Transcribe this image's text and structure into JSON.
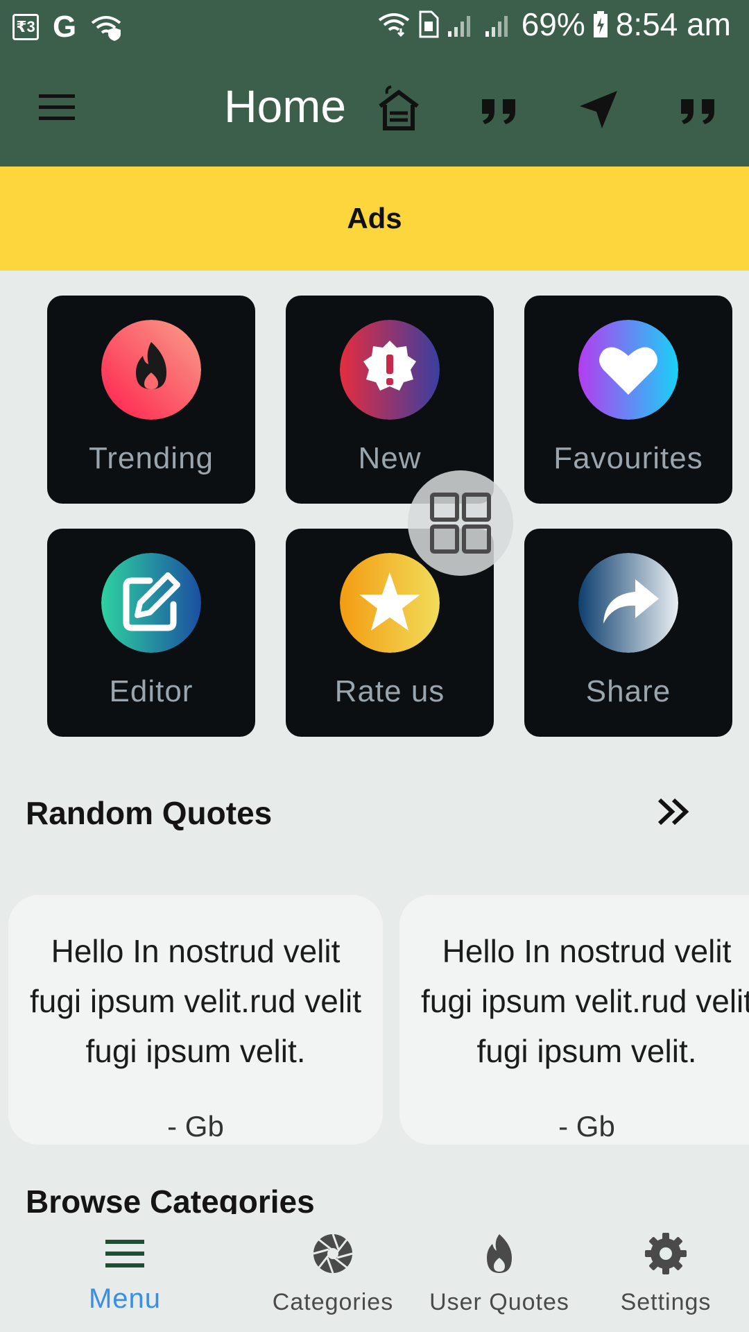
{
  "status_bar": {
    "carrier_badge": "₹3",
    "google_letter": "G",
    "battery": "69%",
    "time": "8:54 am"
  },
  "app_bar": {
    "title": "Home",
    "icons": [
      "menu-icon",
      "home-icon",
      "quote-icon",
      "send-icon",
      "quote-icon"
    ]
  },
  "ads": {
    "label": "Ads"
  },
  "tiles": [
    {
      "label": "Trending",
      "icon": "fire-icon"
    },
    {
      "label": "New",
      "icon": "new-badge-icon"
    },
    {
      "label": "Favourites",
      "icon": "heart-icon"
    },
    {
      "label": "Editor",
      "icon": "edit-icon"
    },
    {
      "label": "Rate us",
      "icon": "star-icon"
    },
    {
      "label": "Share",
      "icon": "share-icon"
    }
  ],
  "random_quotes": {
    "title": "Random Quotes",
    "quotes": [
      {
        "text": "Hello In nostrud velit fugi ipsum velit.rud velit fugi ipsum velit.",
        "author": "- Gb"
      },
      {
        "text": "Hello In nostrud velit fugi ipsum velit.rud velit fugi ipsum velit.",
        "author": "- Gb"
      }
    ]
  },
  "browse_categories": {
    "title": "Browse Categories"
  },
  "bottom_nav": {
    "items": [
      {
        "label": "Menu",
        "icon": "menu-icon",
        "active": true
      },
      {
        "label": "Categories",
        "icon": "aperture-icon",
        "active": false
      },
      {
        "label": "User Quotes",
        "icon": "fire-icon",
        "active": false
      },
      {
        "label": "Settings",
        "icon": "gear-icon",
        "active": false
      }
    ]
  },
  "colors": {
    "app_bar": "#3b5f4a",
    "ads": "#fdd63d",
    "tile": "#0b0f12",
    "background": "#e7ebe9",
    "nav_active": "#3a8ee6"
  }
}
